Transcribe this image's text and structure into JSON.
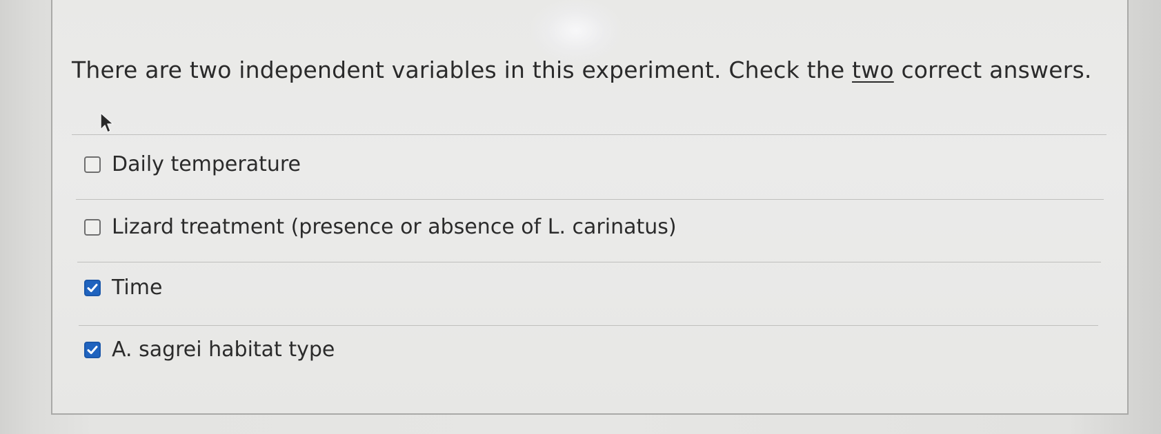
{
  "question": {
    "text_before": "There are two independent variables in this experiment. Check the ",
    "emphasis": "two",
    "text_after": " correct answers."
  },
  "options": [
    {
      "label": "Daily temperature",
      "checked": false
    },
    {
      "label": "Lizard treatment (presence or absence of L. carinatus)",
      "checked": false
    },
    {
      "label": "Time",
      "checked": true
    },
    {
      "label": "A. sagrei habitat type",
      "checked": true
    }
  ],
  "colors": {
    "checkbox_checked": "#1f63bf",
    "text": "#2b2b2b"
  }
}
